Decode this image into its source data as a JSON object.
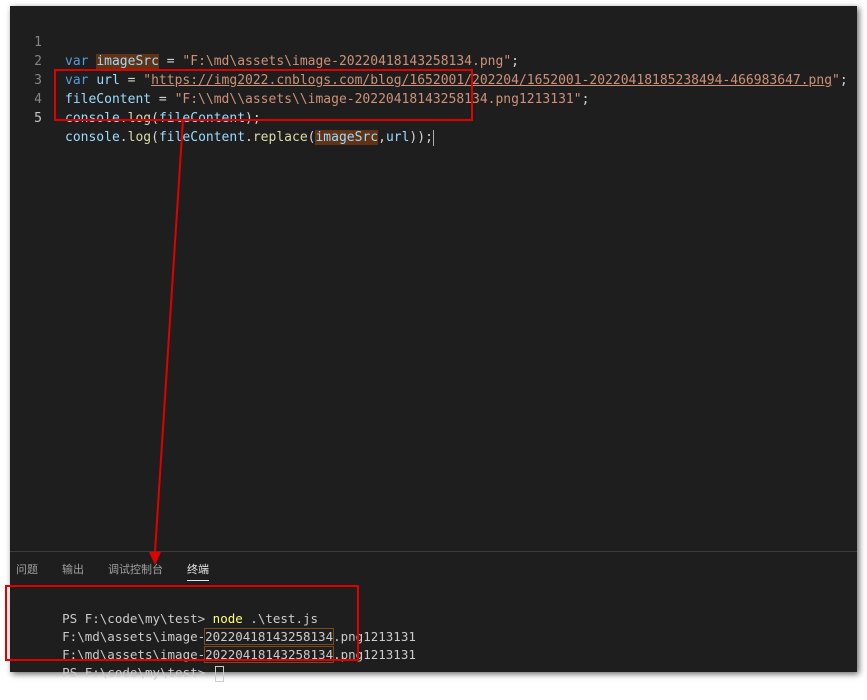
{
  "editor": {
    "lines": [
      {
        "num": "1",
        "t": [
          "var",
          "imageSrc",
          "=",
          "\"F:\\md\\assets\\image-20220418143258134.png\"",
          ";"
        ]
      },
      {
        "num": "2",
        "t": [
          "var",
          "url",
          "=",
          "\"",
          "https://img2022.cnblogs.com/blog/1652001/202204/1652001-20220418185238494-466983647.png",
          "\"",
          ";"
        ]
      },
      {
        "num": "3",
        "t": [
          "fileContent",
          "=",
          "\"F:\\\\md\\\\assets\\\\image-20220418143258134.png1213131\"",
          ";"
        ]
      },
      {
        "num": "4",
        "t": [
          "console",
          ".",
          "log",
          "(",
          "fileContent",
          ");"
        ]
      },
      {
        "num": "5",
        "t": [
          "console",
          ".",
          "log",
          "(",
          "fileContent",
          ".",
          "replace",
          "(",
          "imageSrc",
          ",",
          "url",
          "));"
        ]
      }
    ]
  },
  "panel": {
    "tabs": [
      "问题",
      "输出",
      "调试控制台",
      "终端"
    ],
    "active_tab": "终端"
  },
  "terminal": {
    "lines": [
      {
        "prompt": "PS F:\\code\\my\\test> ",
        "cmd": "node",
        "args": " .\\test.js"
      },
      {
        "pre": "F:\\md\\assets\\image-",
        "hl": "20220418143258134",
        "post": ".png1213131"
      },
      {
        "pre": "F:\\md\\assets\\image-",
        "hl": "20220418143258134",
        "post": ".png1213131"
      },
      {
        "prompt": "PS F:\\code\\my\\test> "
      }
    ]
  },
  "colors": {
    "annotation": "#e00000",
    "background": "#1e1e1e"
  }
}
